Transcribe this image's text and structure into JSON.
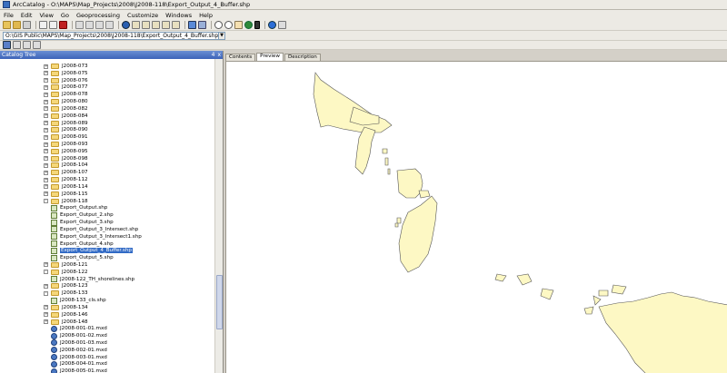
{
  "window": {
    "title": "ArcCatalog - O:\\MAPS\\Map_Projects\\2008\\J2008-118\\Export_Output_4_Buffer.shp"
  },
  "menu": [
    "File",
    "Edit",
    "View",
    "Go",
    "Geoprocessing",
    "Customize",
    "Windows",
    "Help"
  ],
  "location": {
    "value": "O:\\GIS Public\\MAPS\\Map_Projects\\2008\\J2008-118\\Export_Output_4_Buffer.shp"
  },
  "catalog": {
    "title": "Catalog Tree",
    "pin": "4",
    "close": "x"
  },
  "tree": [
    {
      "label": "J2008-073",
      "type": "folder",
      "level": 0,
      "exp": "+"
    },
    {
      "label": "J2008-075",
      "type": "folder",
      "level": 0,
      "exp": "+"
    },
    {
      "label": "J2008-076",
      "type": "folder",
      "level": 0,
      "exp": "+"
    },
    {
      "label": "J2008-077",
      "type": "folder",
      "level": 0,
      "exp": "+"
    },
    {
      "label": "J2008-078",
      "type": "folder",
      "level": 0,
      "exp": "+"
    },
    {
      "label": "J2008-080",
      "type": "folder",
      "level": 0,
      "exp": "+"
    },
    {
      "label": "J2008-082",
      "type": "folder",
      "level": 0,
      "exp": "+"
    },
    {
      "label": "J2008-084",
      "type": "folder",
      "level": 0,
      "exp": "+"
    },
    {
      "label": "J2008-089",
      "type": "folder",
      "level": 0,
      "exp": "+"
    },
    {
      "label": "J2008-090",
      "type": "folder",
      "level": 0,
      "exp": "+"
    },
    {
      "label": "J2008-091",
      "type": "folder",
      "level": 0,
      "exp": "+"
    },
    {
      "label": "J2008-093",
      "type": "folder",
      "level": 0,
      "exp": "+"
    },
    {
      "label": "J2008-095",
      "type": "folder",
      "level": 0,
      "exp": "+"
    },
    {
      "label": "J2008-098",
      "type": "folder",
      "level": 0,
      "exp": "+"
    },
    {
      "label": "J2008-104",
      "type": "folder",
      "level": 0,
      "exp": "+"
    },
    {
      "label": "J2008-107",
      "type": "folder",
      "level": 0,
      "exp": "+"
    },
    {
      "label": "J2008-112",
      "type": "folder",
      "level": 0,
      "exp": "+"
    },
    {
      "label": "J2008-114",
      "type": "folder",
      "level": 0,
      "exp": "+"
    },
    {
      "label": "J2008-115",
      "type": "folder",
      "level": 0,
      "exp": "+"
    },
    {
      "label": "J2008-118",
      "type": "folder",
      "level": 0,
      "exp": "-"
    },
    {
      "label": "Export_Output.shp",
      "type": "shp",
      "level": 1
    },
    {
      "label": "Export_Output_2.shp",
      "type": "shp",
      "level": 1
    },
    {
      "label": "Export_Output_3.shp",
      "type": "shp",
      "level": 1
    },
    {
      "label": "Export_Output_3_Intersect.shp",
      "type": "shp",
      "level": 1
    },
    {
      "label": "Export_Output_3_Intersect1.shp",
      "type": "shp",
      "level": 1
    },
    {
      "label": "Export_Output_4.shp",
      "type": "shp",
      "level": 1
    },
    {
      "label": "Export_Output_4_Buffer.shp",
      "type": "shp",
      "level": 1,
      "selected": true
    },
    {
      "label": "Export_Output_5.shp",
      "type": "shp",
      "level": 1
    },
    {
      "label": "J2008-121",
      "type": "folder",
      "level": 0,
      "exp": "+"
    },
    {
      "label": "J2008-122",
      "type": "folder",
      "level": 0,
      "exp": "-"
    },
    {
      "label": "J2008-122_TH_shorelines.shp",
      "type": "shp",
      "level": 1
    },
    {
      "label": "J2008-123",
      "type": "folder",
      "level": 0,
      "exp": "+"
    },
    {
      "label": "J2008-133",
      "type": "folder",
      "level": 0,
      "exp": "-"
    },
    {
      "label": "J2008-133_cls.shp",
      "type": "shp",
      "level": 1
    },
    {
      "label": "J2008-134",
      "type": "folder",
      "level": 0,
      "exp": "+"
    },
    {
      "label": "J2008-146",
      "type": "folder",
      "level": 0,
      "exp": "+"
    },
    {
      "label": "J2008-148",
      "type": "folder",
      "level": 0,
      "exp": "+"
    },
    {
      "label": "J2008-001-01.mxd",
      "type": "mxd",
      "level": 0
    },
    {
      "label": "J2008-001-02.mxd",
      "type": "mxd",
      "level": 0
    },
    {
      "label": "J2008-001-03.mxd",
      "type": "mxd",
      "level": 0
    },
    {
      "label": "J2008-002-01.mxd",
      "type": "mxd",
      "level": 0
    },
    {
      "label": "J2008-003-01.mxd",
      "type": "mxd",
      "level": 0
    },
    {
      "label": "J2008-004-01.mxd",
      "type": "mxd",
      "level": 0
    },
    {
      "label": "J2008-005-01.mxd",
      "type": "mxd",
      "level": 0
    }
  ],
  "tabs": [
    {
      "label": "Contents",
      "active": false
    },
    {
      "label": "Preview",
      "active": true
    },
    {
      "label": "Description",
      "active": false
    }
  ],
  "preview": {
    "fill_color": "#fdf8c4",
    "stroke_color": "#555555"
  }
}
